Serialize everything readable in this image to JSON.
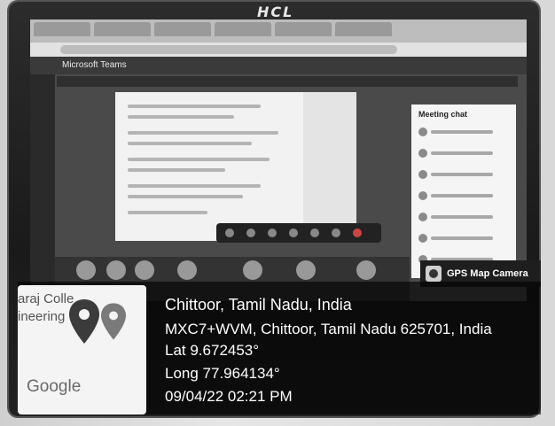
{
  "monitor": {
    "brand": "HCL"
  },
  "screen": {
    "app_title": "Microsoft Teams",
    "chat_title": "Meeting chat"
  },
  "camera_tag": {
    "label": "GPS Map Camera",
    "icon": "camera-icon"
  },
  "map_thumbnail": {
    "map_text": "araj Colle\nineering",
    "google_label": "Google",
    "pins": [
      "map-pin-dark",
      "map-pin-grey"
    ]
  },
  "location": {
    "place": "Chittoor, Tamil Nadu, India",
    "address": "MXC7+WVM, Chittoor, Tamil Nadu 625701, India",
    "lat": "Lat 9.672453°",
    "long": "Long 77.964134°",
    "datetime": "09/04/22 02:21 PM"
  },
  "colors": {
    "overlay": "#000000",
    "text": "#ffffff"
  }
}
